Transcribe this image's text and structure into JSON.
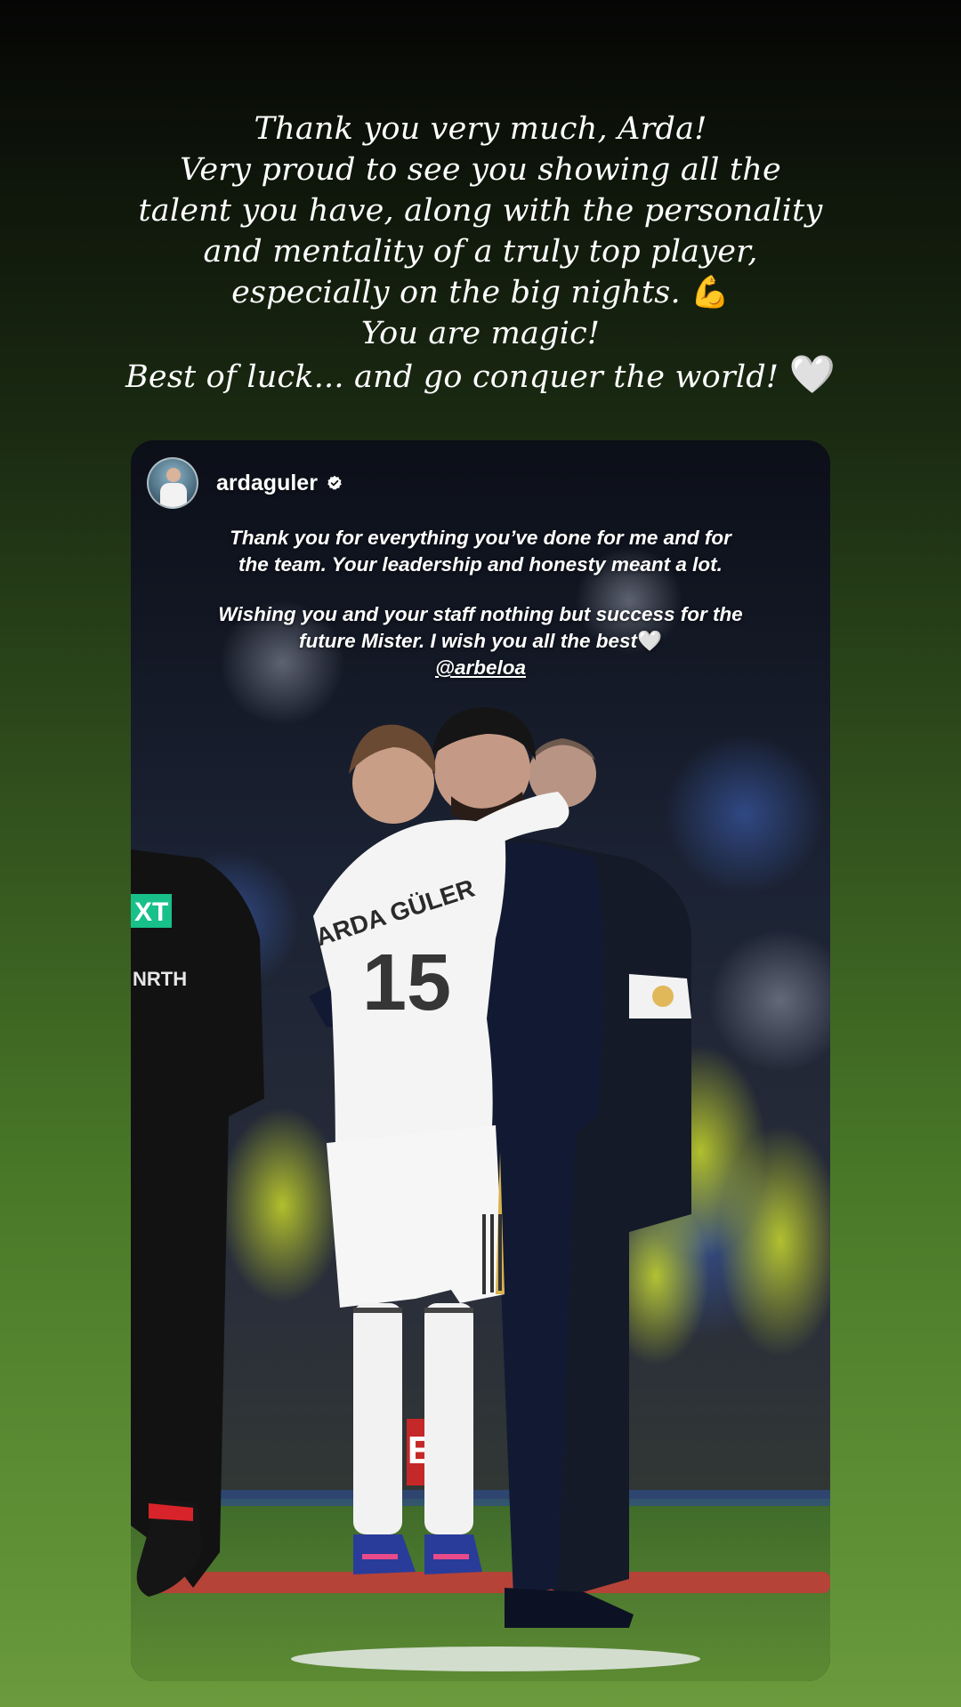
{
  "caption": {
    "lines": [
      "Thank you very much, Arda!",
      "Very proud to see you showing all the",
      "talent you have, along with the personality",
      "and mentality of a truly top player,",
      "especially on the big nights.",
      "You are magic!",
      "Best of luck... and go conquer the world!"
    ],
    "emoji_flex": "💪",
    "emoji_heart": "🤍"
  },
  "story": {
    "username": "ardaguler",
    "verified": true,
    "post": {
      "para1_line1": "Thank you for everything you’ve done for me and for",
      "para1_line2": "the team. Your leadership and honesty meant a lot.",
      "para2_line1": "Wishing you and your staff nothing but success for the",
      "para2_line2": "future Mister. I wish you all the best",
      "heart": "🤍",
      "mention": "@arbeloa"
    },
    "photo": {
      "jersey_name": "ARDA GÜLER",
      "jersey_number": "15",
      "board_text": "Em",
      "sleeve_text_1": "XT",
      "sleeve_text_2": "NRTH"
    }
  },
  "colors": {
    "background_top": "#050505",
    "background_bottom": "#6a9a3c",
    "text": "#ffffff"
  }
}
